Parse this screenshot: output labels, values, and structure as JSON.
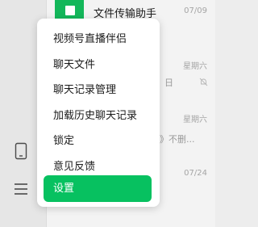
{
  "chats": {
    "first": {
      "title": "文件传输助手",
      "date": "07/09"
    },
    "second": {
      "date": "星期六",
      "snippet": "日"
    },
    "third": {
      "date": "星期六",
      "snippet": "》不删..."
    },
    "fourth": {
      "date": "07/24"
    }
  },
  "menu": {
    "items": [
      {
        "label": "视频号直播伴侣"
      },
      {
        "label": "聊天文件"
      },
      {
        "label": "聊天记录管理"
      },
      {
        "label": "加载历史聊天记录"
      },
      {
        "label": "锁定"
      },
      {
        "label": "意见反馈"
      }
    ],
    "active_item": {
      "label": "设置"
    }
  },
  "icons": {
    "phone": "phone-icon",
    "menu": "hamburger-menu-icon",
    "mute": "mute-bell-icon",
    "file_transfer": "file-transfer-icon"
  },
  "colors": {
    "accent": "#07c160",
    "avatar": "#13b75a"
  }
}
